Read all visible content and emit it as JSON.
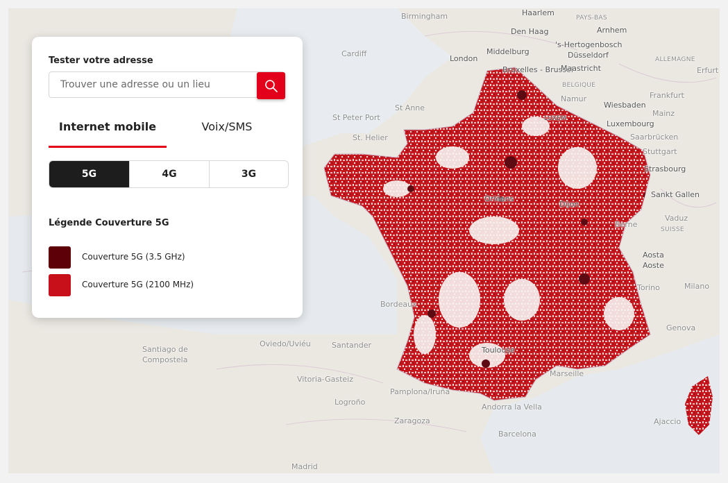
{
  "map": {
    "background_color": "#ece9e3",
    "sea_color": "#dfe4ea",
    "land_color": "#f2eee8",
    "coverage_3500_color": "#6b0a10",
    "coverage_2100_color": "#c4161c",
    "places": [
      {
        "id": "birmingham",
        "label": "Birmingham"
      },
      {
        "id": "haarlem",
        "label": "Haarlem"
      },
      {
        "id": "pays-bas",
        "label": "PAYS-BAS"
      },
      {
        "id": "den-haag",
        "label": "Den Haag"
      },
      {
        "id": "arnhem",
        "label": "Arnhem"
      },
      {
        "id": "cardiff",
        "label": "Cardiff"
      },
      {
        "id": "london",
        "label": "London"
      },
      {
        "id": "middelburg",
        "label": "Middelburg"
      },
      {
        "id": "s-hertogenbosch",
        "label": "'s-Hertogenbosch"
      },
      {
        "id": "dusseldorf",
        "label": "Düsseldorf"
      },
      {
        "id": "allemagne",
        "label": "ALLEMAGNE"
      },
      {
        "id": "bruxelles",
        "label": "Bruxelles - Brussel"
      },
      {
        "id": "maastricht",
        "label": "Maastricht"
      },
      {
        "id": "erfurt",
        "label": "Erfurt"
      },
      {
        "id": "belgique",
        "label": "BELGIQUE"
      },
      {
        "id": "namur",
        "label": "Namur"
      },
      {
        "id": "frankfurt",
        "label": "Frankfurt"
      },
      {
        "id": "wiesbaden",
        "label": "Wiesbaden"
      },
      {
        "id": "mainz",
        "label": "Mainz"
      },
      {
        "id": "st-peter-port",
        "label": "St Peter Port"
      },
      {
        "id": "st-anne",
        "label": "St Anne"
      },
      {
        "id": "luxembourg-short",
        "label": "LUXEM"
      },
      {
        "id": "luxembourg",
        "label": "Luxembourg"
      },
      {
        "id": "st-helier",
        "label": "St. Helier"
      },
      {
        "id": "saarbrucken",
        "label": "Saarbrücken"
      },
      {
        "id": "stuttgart",
        "label": "Stuttgart"
      },
      {
        "id": "strasbourg",
        "label": "Strasbourg"
      },
      {
        "id": "orleans",
        "label": "Orléans"
      },
      {
        "id": "dijon",
        "label": "Dijon"
      },
      {
        "id": "sankt-gallen",
        "label": "Sankt Gallen"
      },
      {
        "id": "berne",
        "label": "Berne"
      },
      {
        "id": "vaduz",
        "label": "Vaduz"
      },
      {
        "id": "suisse",
        "label": "SUISSE"
      },
      {
        "id": "aosta",
        "label": "Aosta"
      },
      {
        "id": "aoste",
        "label": "Aoste"
      },
      {
        "id": "milano",
        "label": "Milano"
      },
      {
        "id": "torino",
        "label": "Torino"
      },
      {
        "id": "bordeaux",
        "label": "Bordeaux"
      },
      {
        "id": "genova",
        "label": "Genova"
      },
      {
        "id": "santiago",
        "label": "Santiago de"
      },
      {
        "id": "compostela",
        "label": "Compostela"
      },
      {
        "id": "oviedo",
        "label": "Oviedo/Uviéu"
      },
      {
        "id": "santander",
        "label": "Santander"
      },
      {
        "id": "toulouse",
        "label": "Toulouse"
      },
      {
        "id": "vitoria",
        "label": "Vitoria-Gasteiz"
      },
      {
        "id": "marseille",
        "label": "Marseille"
      },
      {
        "id": "pamplona",
        "label": "Pamplona/Iruña"
      },
      {
        "id": "logrono",
        "label": "Logroño"
      },
      {
        "id": "andorra",
        "label": "Andorra la Vella"
      },
      {
        "id": "ajaccio",
        "label": "Ajaccio"
      },
      {
        "id": "zaragoza",
        "label": "Zaragoza"
      },
      {
        "id": "barcelona",
        "label": "Barcelona"
      },
      {
        "id": "madrid",
        "label": "Madrid"
      }
    ]
  },
  "panel": {
    "title": "Tester votre adresse",
    "search": {
      "placeholder": "Trouver une adresse ou un lieu",
      "value": ""
    },
    "tabs": [
      {
        "label": "Internet mobile",
        "active": true
      },
      {
        "label": "Voix/SMS",
        "active": false
      }
    ],
    "networks": [
      {
        "label": "5G",
        "active": true
      },
      {
        "label": "4G",
        "active": false
      },
      {
        "label": "3G",
        "active": false
      }
    ],
    "legend": {
      "title": "Légende Couverture 5G",
      "items": [
        {
          "label": "Couverture 5G (3.5 GHz)",
          "color": "#5e0008"
        },
        {
          "label": "Couverture 5G (2100 MHz)",
          "color": "#c8101a"
        }
      ]
    }
  },
  "icons": {
    "search": "search-icon"
  }
}
